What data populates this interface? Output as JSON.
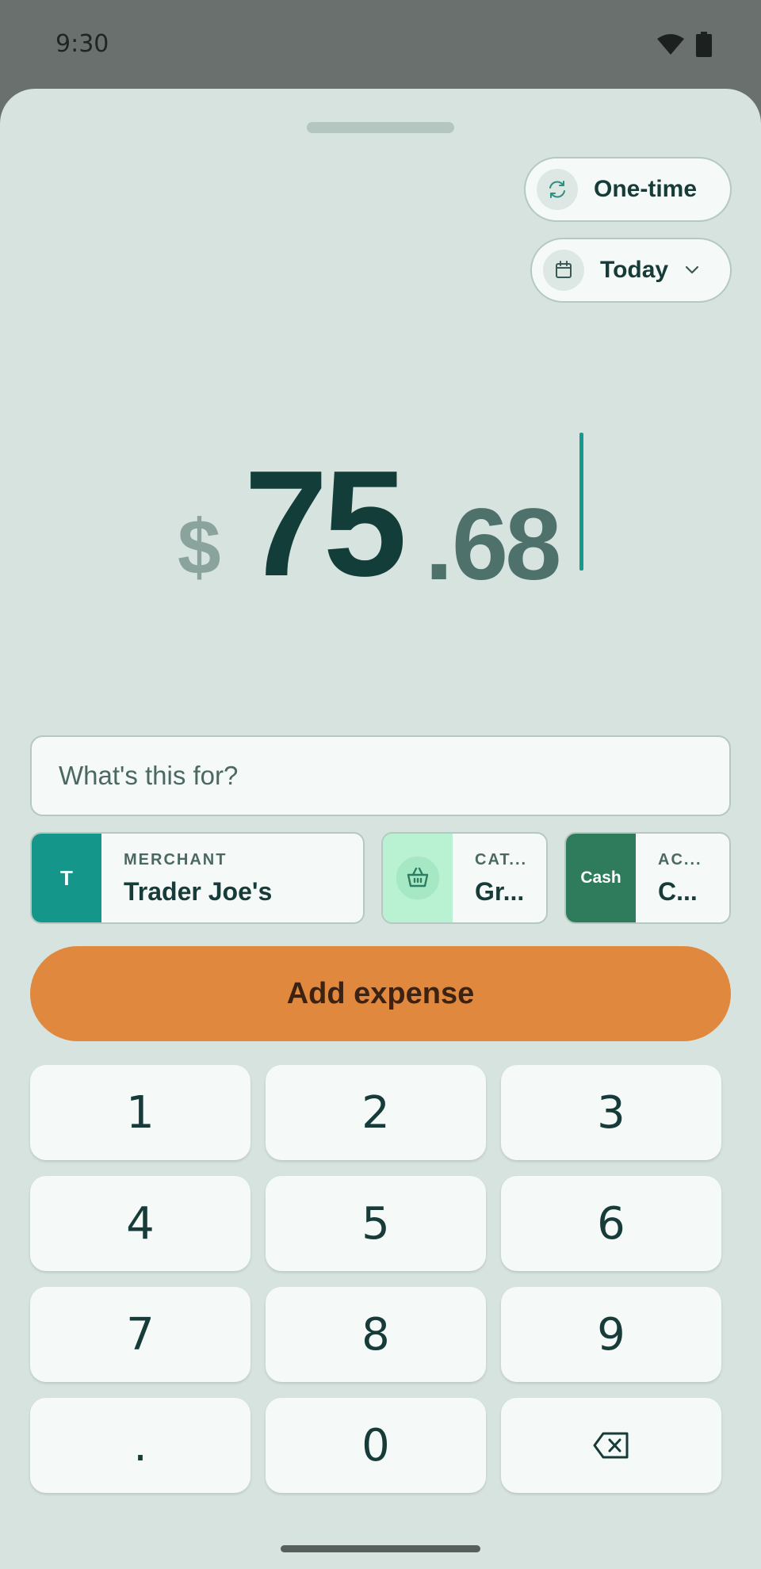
{
  "status_bar": {
    "time": "9:30"
  },
  "recurrence_chip": {
    "label": "One-time",
    "icon": "repeat-icon"
  },
  "date_chip": {
    "label": "Today",
    "icon": "calendar-icon"
  },
  "amount": {
    "currency": "$",
    "whole": "75",
    "dot": ".",
    "fraction": "68"
  },
  "description": {
    "placeholder": "What's this for?",
    "value": ""
  },
  "merchant": {
    "caption": "MERCHANT",
    "value": "Trader Joe's",
    "initial": "T",
    "color": "#14968a"
  },
  "category": {
    "caption": "CAT...",
    "value": "Gr...",
    "icon": "basket-icon",
    "color": "#b8f2d2"
  },
  "account": {
    "caption": "AC...",
    "value": "C...",
    "badge": "Cash",
    "color": "#2e7c5b"
  },
  "add_button": {
    "label": "Add expense",
    "color": "#e0883e"
  },
  "keypad": {
    "keys": [
      "1",
      "2",
      "3",
      "4",
      "5",
      "6",
      "7",
      "8",
      "9",
      ".",
      "0"
    ],
    "backspace_icon": "backspace-icon"
  }
}
